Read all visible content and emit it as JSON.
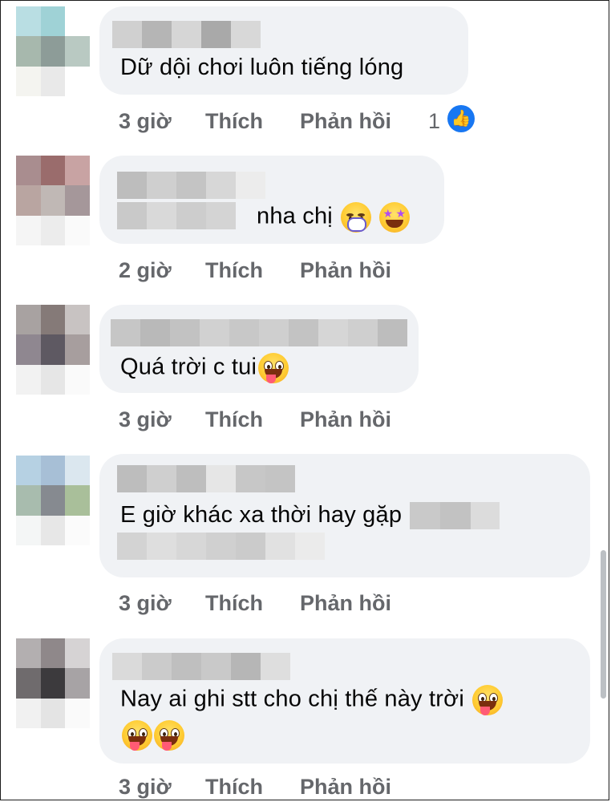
{
  "icons": {
    "like_reaction": "thumbs-up-icon",
    "grin_tongue": "grinning-tongue-emoji",
    "star_struck": "star-struck-emoji",
    "hand_over_mouth": "hand-over-mouth-emoji"
  },
  "colors": {
    "bubble": "#f0f2f5",
    "action_text": "#65676b",
    "like_blue": "#1877f2"
  },
  "comments": [
    {
      "text": "Dữ dội chơi luôn tiếng lóng",
      "time": "3 giờ",
      "like": "Thích",
      "reply": "Phản hồi",
      "reaction_count": "1"
    },
    {
      "text": "nha chị",
      "time": "2 giờ",
      "like": "Thích",
      "reply": "Phản hồi"
    },
    {
      "text": "Quá trời c tui",
      "time": "3 giờ",
      "like": "Thích",
      "reply": "Phản hồi"
    },
    {
      "text": "E giờ khác xa thời hay gặp",
      "time": "3 giờ",
      "like": "Thích",
      "reply": "Phản hồi"
    },
    {
      "text": "Nay ai ghi stt cho chị thế này trời",
      "time": "3 giờ",
      "like": "Thích",
      "reply": "Phản hồi"
    }
  ]
}
